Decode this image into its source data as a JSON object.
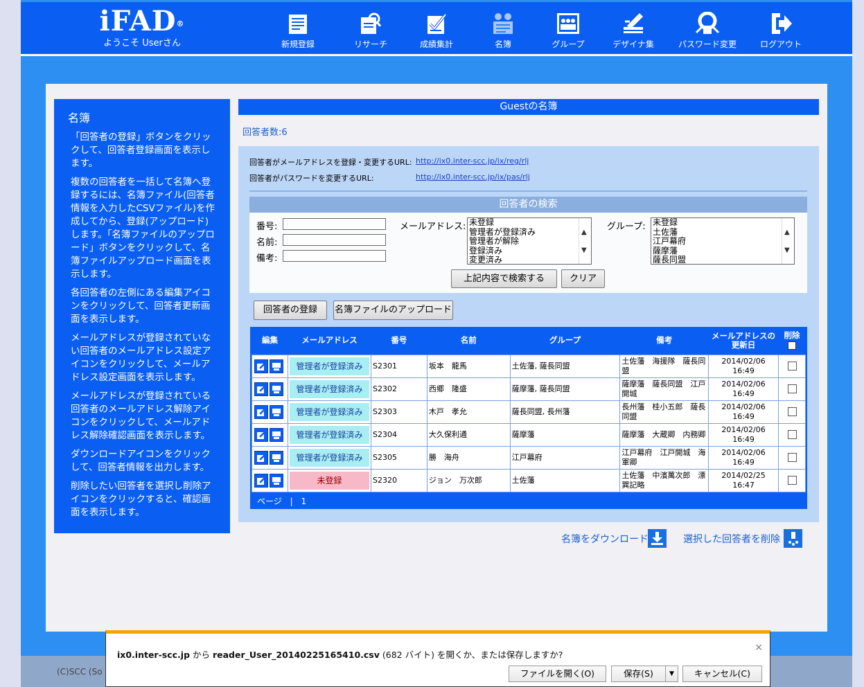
{
  "header": {
    "logo": "iFAD",
    "logo_mark": "®",
    "welcome": "ようこそ Userさん",
    "nav": [
      {
        "label": "新規登録",
        "icon": "new-register-icon"
      },
      {
        "label": "リサーチ",
        "icon": "research-icon"
      },
      {
        "label": "成績集計",
        "icon": "results-icon"
      },
      {
        "label": "名簿",
        "icon": "roster-icon"
      },
      {
        "label": "グループ",
        "icon": "group-icon"
      },
      {
        "label": "デザイナ集",
        "icon": "designer-icon"
      },
      {
        "label": "パスワード変更",
        "icon": "password-icon"
      },
      {
        "label": "ログアウト",
        "icon": "logout-icon"
      }
    ]
  },
  "sidebar": {
    "title": "名簿",
    "paragraphs": [
      "「回答者の登録」ボタンをクリックして、回答者登録画面を表示します。",
      "複数の回答者を一括して名簿へ登録するには、名簿ファイル(回答者情報を入力したCSVファイル)を作成してから、登録(アップロード)します。「名簿ファイルのアップロード」ボタンをクリックして、名簿ファイルアップロード画面を表示します。",
      "各回答者の左側にある編集アイコンをクリックして、回答者更新画面を表示します。",
      "メールアドレスが登録されていない回答者のメールアドレス設定アイコンをクリックして、メールアドレス設定画面を表示します。",
      "メールアドレスが登録されている回答者のメールアドレス解除アイコンをクリックして、メールアドレス解除確認画面を表示します。",
      "ダウンロードアイコンをクリックして、回答者情報を出力します。",
      "削除したい回答者を選択し削除アイコンをクリックすると、確認画面を表示します。"
    ]
  },
  "main": {
    "title": "Guestの名簿",
    "count": "回答者数:6",
    "url_reg_label": "回答者がメールアドレスを登録・変更するURL:",
    "url_reg": "http://ix0.inter-scc.jp/ix/reg/rlj",
    "url_pas_label": "回答者がパスワードを変更するURL:",
    "url_pas": "http://ix0.inter-scc.jp/ix/pas/rlj"
  },
  "search": {
    "title": "回答者の検索",
    "number_label": "番号:",
    "name_label": "名前:",
    "note_label": "備考:",
    "mail_label": "メールアドレス:",
    "mail_options": [
      "未登録",
      "管理者が登録済み",
      "管理者が解除",
      "登録済み",
      "変更済み"
    ],
    "group_label": "グループ:",
    "group_options": [
      "未登録",
      "土佐藩",
      "江戸幕府",
      "薩摩藩",
      "薩長同盟"
    ],
    "search_button": "上記内容で検索する",
    "clear_button": "クリア"
  },
  "actions": {
    "register_button": "回答者の登録",
    "upload_button": "名簿ファイルのアップロード"
  },
  "table": {
    "headers": [
      "編集",
      "メールアドレス",
      "番号",
      "名前",
      "グループ",
      "備考",
      "メールアドレスの更新日",
      "削除"
    ],
    "rows": [
      {
        "mail": "管理者が登録済み",
        "mail_state": "ok",
        "number": "S2301",
        "name": "坂本　龍馬",
        "group": "土佐藩, 薩長同盟",
        "note": "土佐藩　海援隊　薩長同盟",
        "updated": "2014/02/06 16:49"
      },
      {
        "mail": "管理者が登録済み",
        "mail_state": "ok",
        "number": "S2302",
        "name": "西郷　隆盛",
        "group": "薩摩藩, 薩長同盟",
        "note": "薩摩藩　薩長同盟　江戸開城",
        "updated": "2014/02/06 16:49"
      },
      {
        "mail": "管理者が登録済み",
        "mail_state": "ok",
        "number": "S2303",
        "name": "木戸　孝允",
        "group": "薩長同盟, 長州藩",
        "note": "長州藩　桂小五郎　薩長同盟",
        "updated": "2014/02/06 16:49"
      },
      {
        "mail": "管理者が登録済み",
        "mail_state": "ok",
        "number": "S2304",
        "name": "大久保利通",
        "group": "薩摩藩",
        "note": "薩摩藩　大蔵卿　内務卿",
        "updated": "2014/02/06 16:49"
      },
      {
        "mail": "管理者が登録済み",
        "mail_state": "ok",
        "number": "S2305",
        "name": "勝　海舟",
        "group": "江戸幕府",
        "note": "江戸幕府　江戸開城　海軍卿",
        "updated": "2014/02/06 16:49"
      },
      {
        "mail": "未登録",
        "mail_state": "ng",
        "number": "S2320",
        "name": "ジョン　万次郎",
        "group": "土佐藩",
        "note": "土佐藩　中濱萬次郎　漂巽記略",
        "updated": "2014/02/25 16:47"
      }
    ],
    "page_label": "ページ",
    "page_sep": "|",
    "page_number": "1"
  },
  "bottom": {
    "download_link": "名簿をダウンロード",
    "delete_link": "選択した回答者を削除"
  },
  "footer": {
    "text": "(C)SCC (So"
  },
  "dialog": {
    "host": "ix0.inter-scc.jp",
    "from": " から ",
    "filename": "reader_User_20140225165410.csv",
    "rest": " (682 バイト) を開くか、または保存しますか?",
    "open_button": "ファイルを開く(O)",
    "save_button": "保存(S)",
    "save_dropdown": "▼",
    "cancel_button": "キャンセル(C)",
    "close": "×"
  }
}
